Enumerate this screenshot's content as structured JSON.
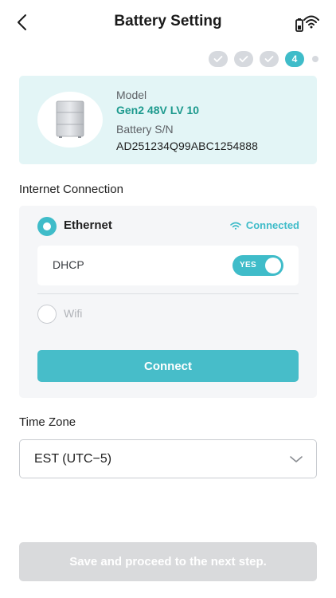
{
  "header": {
    "title": "Battery Setting",
    "back_icon": "chevron-left-icon",
    "device_icon": "battery-wifi-icon"
  },
  "steps": {
    "completed": 3,
    "current_label": "4",
    "total": 5,
    "accent": "#3fbcc9"
  },
  "battery": {
    "model_label": "Model",
    "model_value": "Gen2 48V LV 10",
    "sn_label": "Battery S/N",
    "sn_value": "AD251234Q99ABC1254888",
    "card_color": "#e3f5f6",
    "model_color": "#1d9a8e"
  },
  "internet": {
    "section_label": "Internet Connection",
    "ethernet_label": "Ethernet",
    "ethernet_selected": true,
    "status_text": "Connected",
    "dhcp_label": "DHCP",
    "dhcp_toggle_text": "YES",
    "dhcp_enabled": true,
    "wifi_label": "Wifi",
    "wifi_selected": false,
    "connect_label": "Connect"
  },
  "timezone": {
    "section_label": "Time Zone",
    "selected": "EST (UTC−5)"
  },
  "footer": {
    "save_label": "Save and proceed to the next step.",
    "save_enabled": false
  }
}
